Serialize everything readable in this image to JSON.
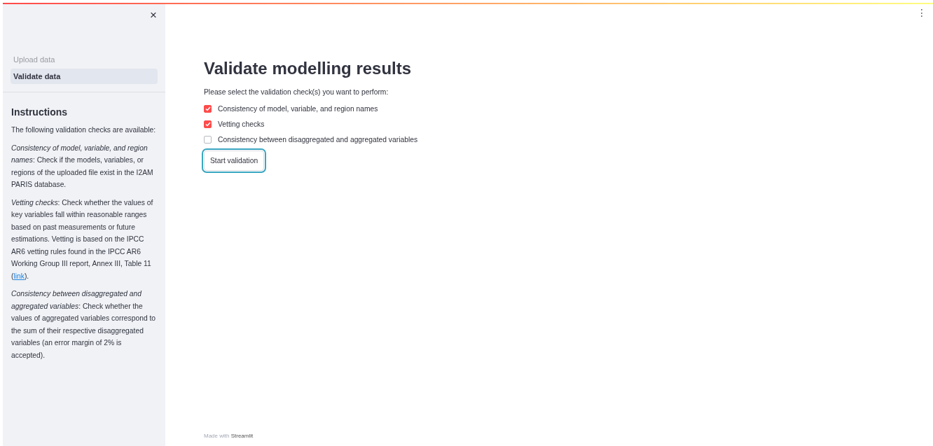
{
  "sidebar": {
    "close": "×",
    "nav": [
      {
        "label": "Upload data",
        "selected": false
      },
      {
        "label": "Validate data",
        "selected": true
      }
    ],
    "heading": "Instructions",
    "paragraphs": [
      {
        "text": "The following validation checks are available:"
      },
      {
        "text": "*Consistency of model, variable, and region names*: Check if the models, variables, or regions of the uploaded file exist in the I2AM PARIS database."
      },
      {
        "text": "*Vetting checks*: Check whether the values of key variables fall within reasonable ranges based on past measurements or future estimations. Vetting is based on the IPCC AR6 vetting rules found in the IPCC AR6 Working Group III report, Annex III, Table 11 (",
        "link": "link",
        "after": ")."
      },
      {
        "text": "*Consistency between disaggregated and aggregated variables*: Check whether the values of aggregated variables correspond to the sum of their respective disaggregated variables (an error margin of 2% is accepted)."
      }
    ]
  },
  "menu": "⋮",
  "main": {
    "title": "Validate modelling results",
    "prompt": "Please select the validation check(s) you want to perform:",
    "checks": [
      {
        "label": "Consistency of model, variable, and region names",
        "checked": true
      },
      {
        "label": "Vetting checks",
        "checked": true
      },
      {
        "label": "Consistency between disaggregated and aggregated variables",
        "checked": false
      }
    ],
    "button": {
      "label": "Start validation",
      "focused": true
    }
  },
  "footer": {
    "text": "Made with ",
    "brand": "Streamlit"
  }
}
